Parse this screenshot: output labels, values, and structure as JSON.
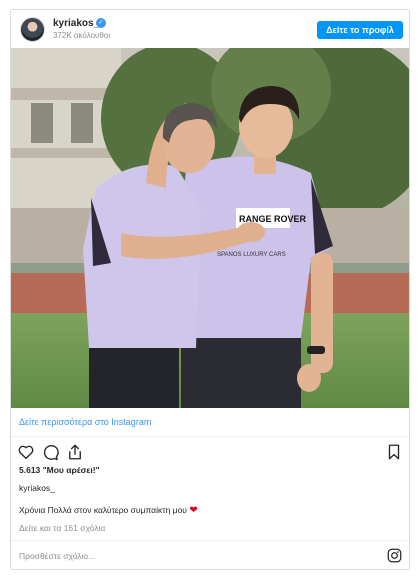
{
  "header": {
    "username": "kyriakos_",
    "verified_glyph": "✓",
    "followers": "372K ακόλουθοι",
    "profile_button": "Δείτε το προφίλ"
  },
  "photo": {
    "jersey_sponsor": "RANGE ROVER",
    "jersey_subtext": "SPANOS LUXURY CARS"
  },
  "more_link": "Δείτε περισσότερα στο Instagram",
  "actions": {
    "like_icon": "heart-icon",
    "comment_icon": "comment-icon",
    "share_icon": "share-icon",
    "save_icon": "bookmark-icon"
  },
  "likes": "5.613 \"Μου αρέσει!\"",
  "author": "kyriakos_",
  "caption": "Χρόνια Πολλά στον καλύτερο συμπαίκτη μου",
  "caption_emoji": "❤",
  "comments_link": "Δείτε και τα 161 σχόλια",
  "comment_placeholder": "Προσθέστε σχόλιο...",
  "colors": {
    "accent": "#3897f0",
    "button": "#0095f6",
    "text": "#262626",
    "muted": "#8e8e8e",
    "jersey": "#cdc3ea"
  }
}
